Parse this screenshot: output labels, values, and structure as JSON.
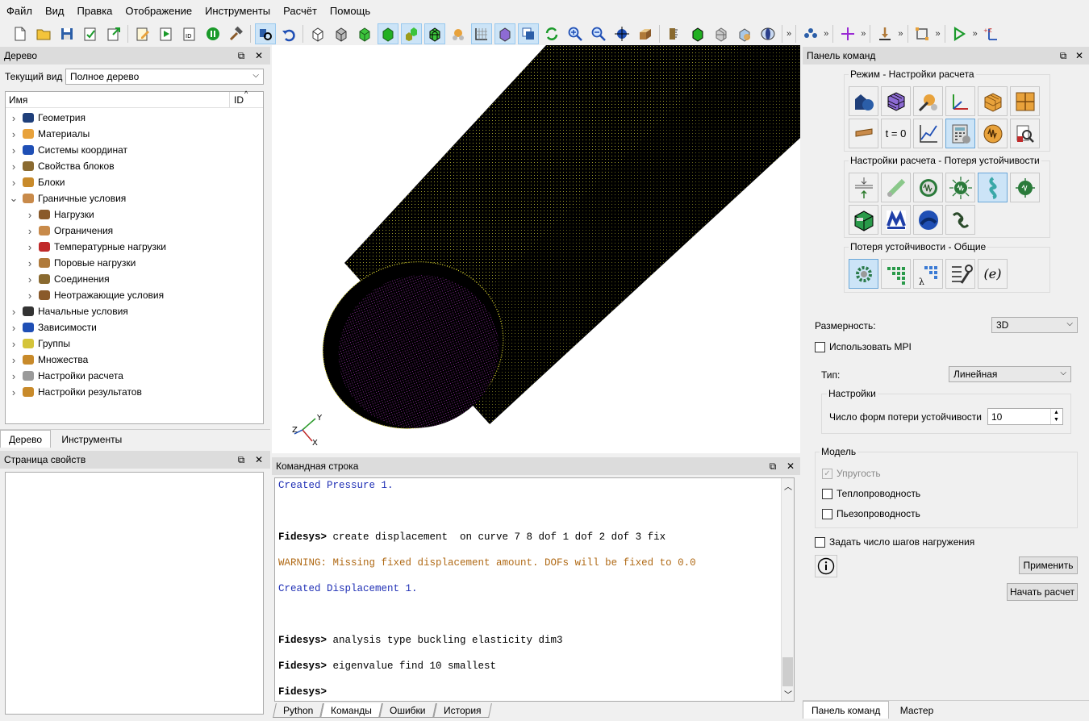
{
  "menu": [
    "Файл",
    "Вид",
    "Правка",
    "Отображение",
    "Инструменты",
    "Расчёт",
    "Помощь"
  ],
  "tree_panel": {
    "title": "Дерево",
    "current_view_label": "Текущий вид",
    "current_view_value": "Полное дерево",
    "col_name": "Имя",
    "col_id": "ID",
    "items": [
      {
        "label": "Геометрия",
        "level": 0,
        "icon": "geometry-icon"
      },
      {
        "label": "Материалы",
        "level": 0,
        "icon": "materials-icon"
      },
      {
        "label": "Системы координат",
        "level": 0,
        "icon": "coordinate-systems-icon"
      },
      {
        "label": "Свойства блоков",
        "level": 0,
        "icon": "block-properties-icon"
      },
      {
        "label": "Блоки",
        "level": 0,
        "icon": "blocks-icon"
      },
      {
        "label": "Граничные условия",
        "level": 0,
        "icon": "boundary-conditions-icon",
        "expanded": true
      },
      {
        "label": "Нагрузки",
        "level": 1,
        "icon": "loads-icon"
      },
      {
        "label": "Ограничения",
        "level": 1,
        "icon": "restraints-icon"
      },
      {
        "label": "Температурные нагрузки",
        "level": 1,
        "icon": "temperature-loads-icon"
      },
      {
        "label": "Поровые нагрузки",
        "level": 1,
        "icon": "pore-loads-icon"
      },
      {
        "label": "Соединения",
        "level": 1,
        "icon": "connections-icon"
      },
      {
        "label": "Неотражающие условия",
        "level": 1,
        "icon": "nonreflecting-icon"
      },
      {
        "label": "Начальные условия",
        "level": 0,
        "icon": "initial-conditions-icon"
      },
      {
        "label": "Зависимости",
        "level": 0,
        "icon": "dependencies-icon"
      },
      {
        "label": "Группы",
        "level": 0,
        "icon": "groups-icon"
      },
      {
        "label": "Множества",
        "level": 0,
        "icon": "sets-icon"
      },
      {
        "label": "Настройки расчета",
        "level": 0,
        "icon": "analysis-settings-icon"
      },
      {
        "label": "Настройки результатов",
        "level": 0,
        "icon": "results-settings-icon"
      }
    ],
    "tabs": [
      "Дерево",
      "Инструменты"
    ]
  },
  "properties_panel": {
    "title": "Страница свойств"
  },
  "viewport": {
    "axes": {
      "y": "Y",
      "z": "Z",
      "x": "X"
    }
  },
  "command_line": {
    "title": "Командная строка",
    "lines": [
      {
        "type": "info",
        "text": "Created Pressure 1."
      },
      {
        "type": "cmd",
        "prompt": "Fidesys>",
        "text": " create displacement  on curve 7 8 dof 1 dof 2 dof 3 fix"
      },
      {
        "type": "warn",
        "text": "WARNING: Missing fixed displacement amount. DOFs will be fixed to 0.0"
      },
      {
        "type": "info",
        "text": "Created Displacement 1."
      },
      {
        "type": "cmd",
        "prompt": "Fidesys>",
        "text": " analysis type buckling elasticity dim3"
      },
      {
        "type": "cmd",
        "prompt": "Fidesys>",
        "text": " eigenvalue find 10 smallest"
      },
      {
        "type": "cmd",
        "prompt": "Fidesys>",
        "text": ""
      }
    ],
    "tabs": [
      "Python",
      "Команды",
      "Ошибки",
      "История"
    ]
  },
  "command_panel": {
    "title": "Панель команд",
    "mode_group": "Режим - Настройки расчета",
    "buckling_group": "Настройки расчета - Потеря устойчивости",
    "general_group": "Потеря устойчивости - Общие",
    "mode_t0_label": "t = 0",
    "dimension_label": "Размерность:",
    "dimension_value": "3D",
    "use_mpi_label": "Использовать MPI",
    "type_label": "Тип:",
    "type_value": "Линейная",
    "settings_group": "Настройки",
    "num_modes_label": "Число форм потери устойчивости",
    "num_modes_value": "10",
    "model_group": "Модель",
    "elasticity_label": "Упругость",
    "thermal_label": "Теплопроводность",
    "piezo_label": "Пьезопроводность",
    "load_steps_label": "Задать число шагов нагружения",
    "apply_label": "Применить",
    "start_label": "Начать расчет",
    "tabs": [
      "Панель команд",
      "Мастер"
    ],
    "colors": {
      "selected_bg": "#cce4f7",
      "selected_border": "#6aa7d8"
    }
  }
}
